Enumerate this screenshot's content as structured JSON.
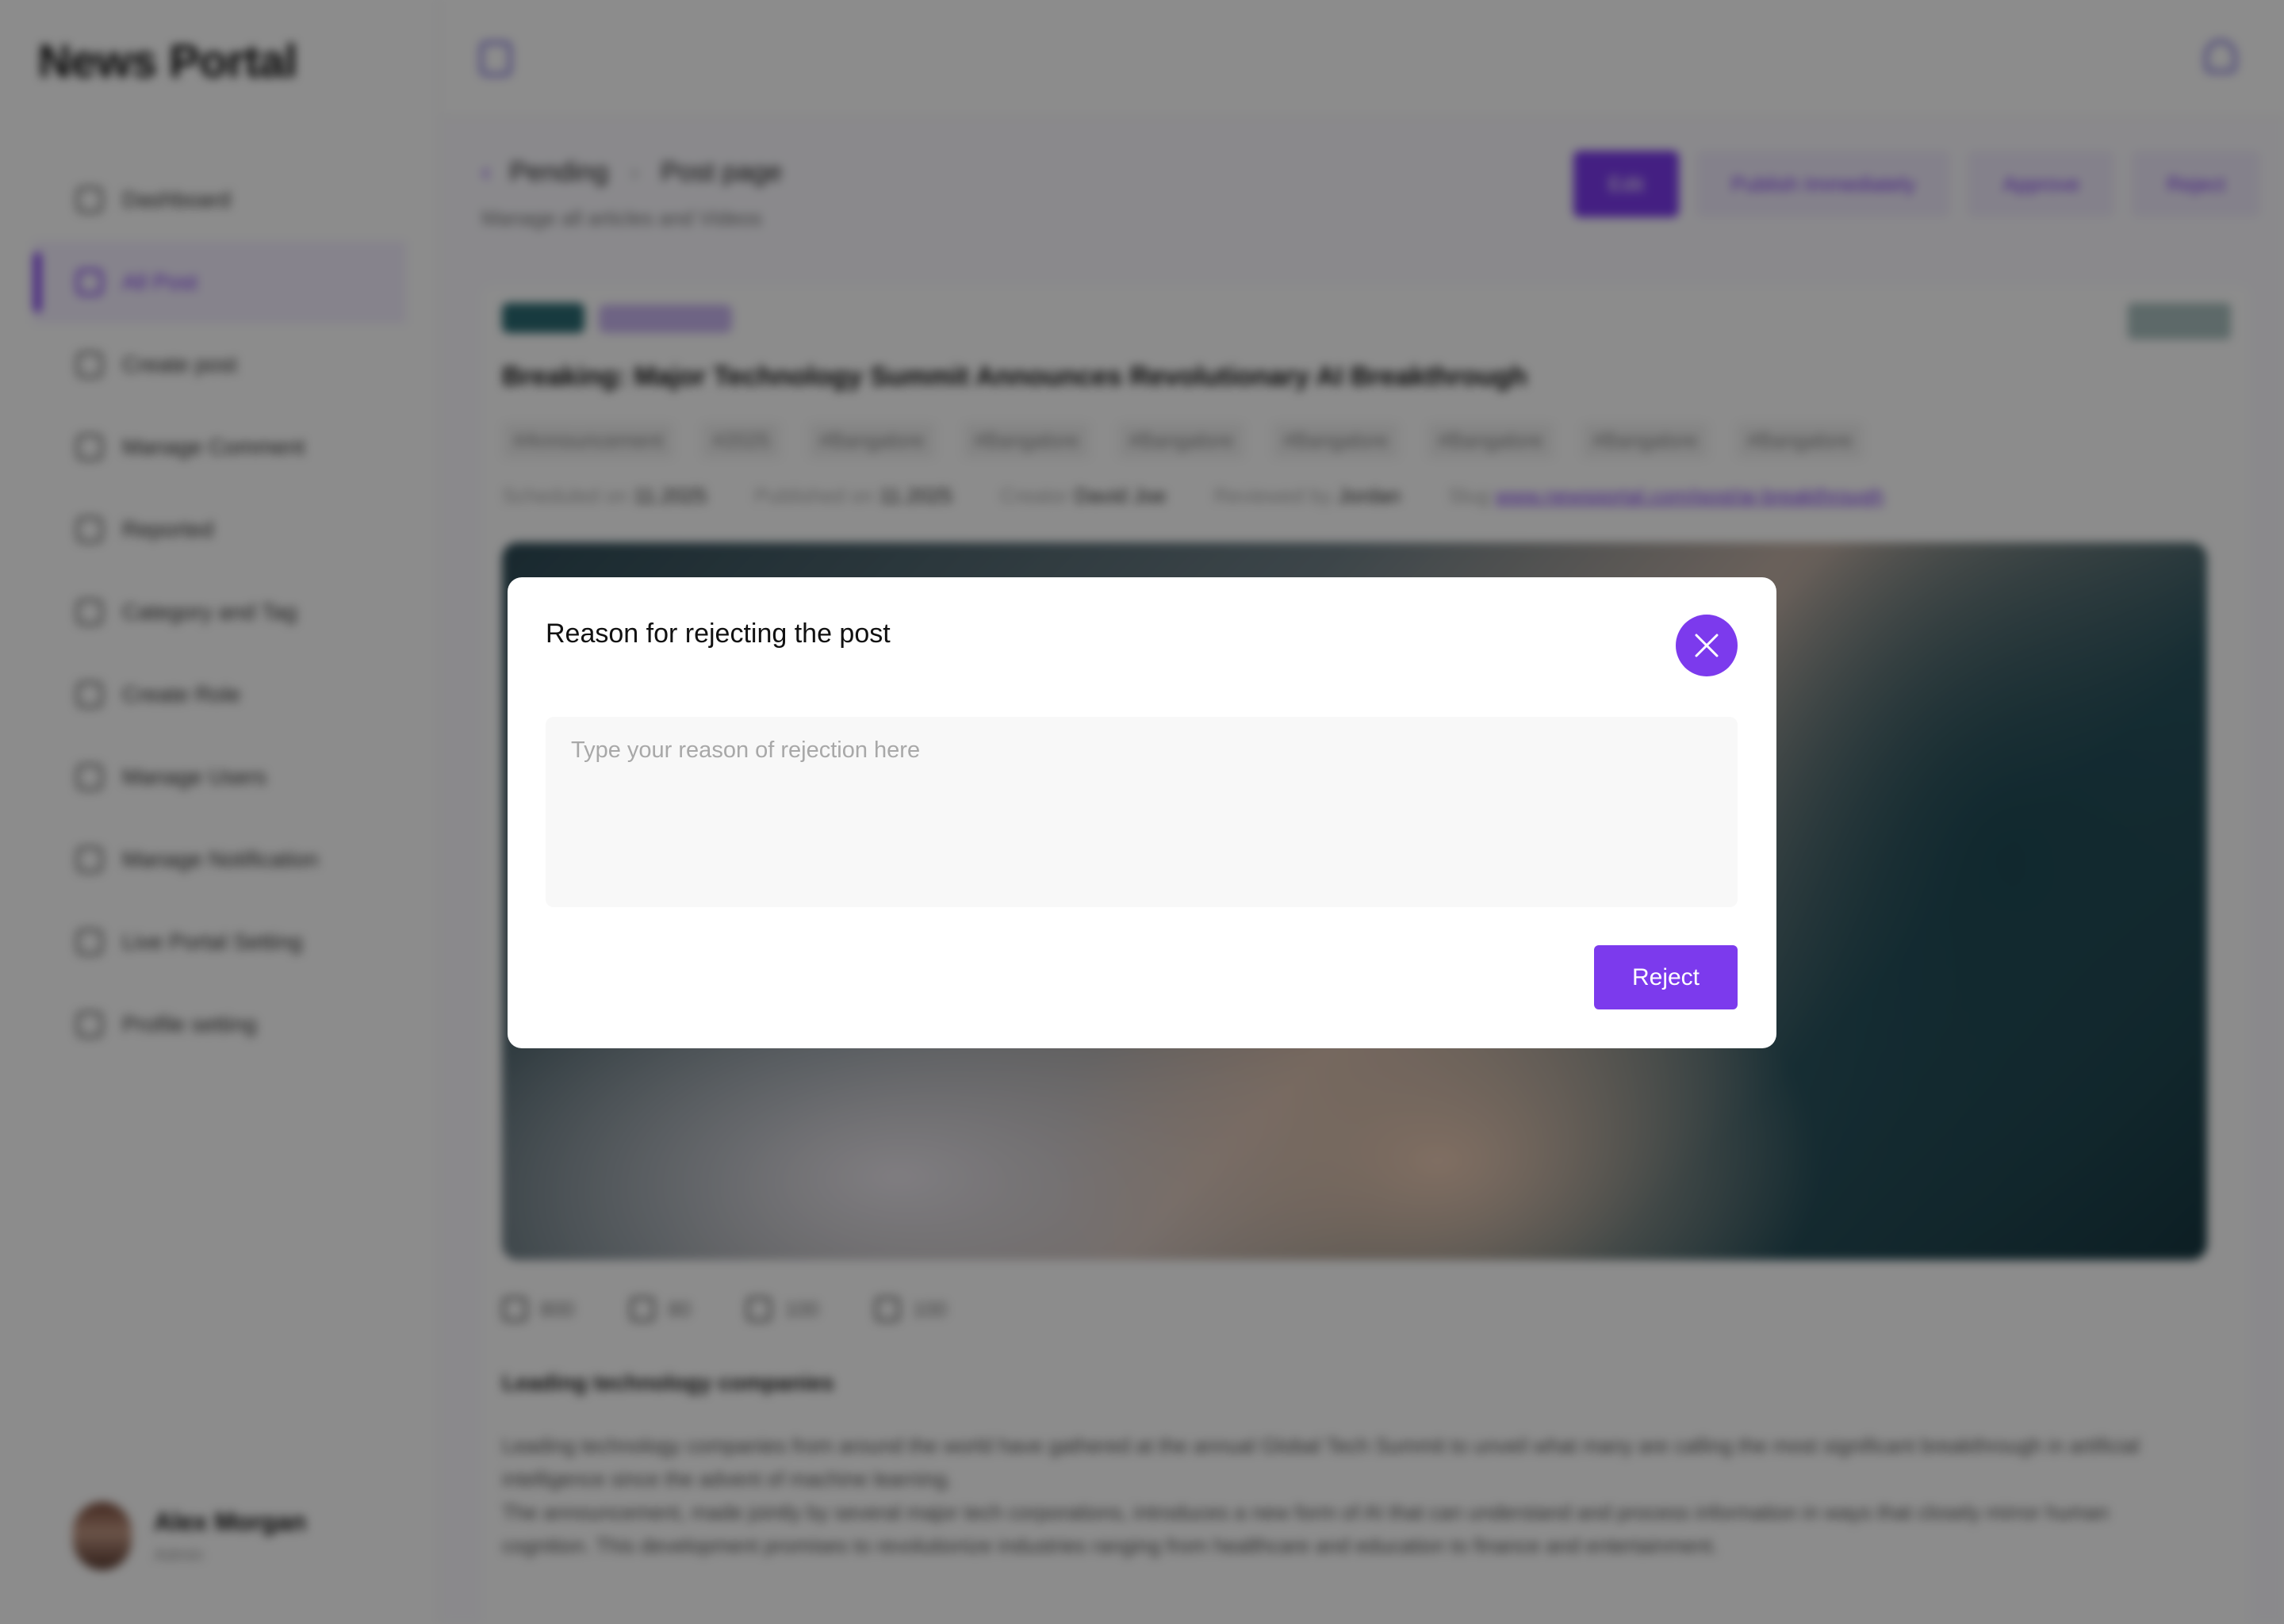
{
  "brand": "News Portal",
  "sidebar": {
    "items": [
      {
        "label": "Dashboard",
        "icon": "dashboard-icon"
      },
      {
        "label": "All Post",
        "icon": "document-icon",
        "active": true
      },
      {
        "label": "Create post",
        "icon": "plus-circle-icon"
      },
      {
        "label": "Manage Comment",
        "icon": "comment-icon"
      },
      {
        "label": "Reported",
        "icon": "flag-icon"
      },
      {
        "label": "Category and Tag",
        "icon": "tag-icon"
      },
      {
        "label": "Create Role",
        "icon": "user-icon"
      },
      {
        "label": "Manage Users",
        "icon": "users-icon"
      },
      {
        "label": "Manage Notification",
        "icon": "bell-icon"
      },
      {
        "label": "Live Portal Setting",
        "icon": "calendar-icon"
      },
      {
        "label": "Profile setting",
        "icon": "gear-icon"
      }
    ]
  },
  "profile": {
    "name": "Alex Morgan",
    "role": "Admin"
  },
  "header": {
    "crumb_1": "Pending",
    "crumb_2": "Post page",
    "subtitle": "Manage all articles and Videos",
    "actions": {
      "edit": "Edit",
      "publish": "Publish Immediately",
      "approve": "Approve",
      "reject": "Reject"
    }
  },
  "post": {
    "title": "Breaking: Major Technology Summit Announces Revolutionary AI Breakthrough",
    "tags": [
      "#Announcement",
      "#2025",
      "#Bangalore",
      "#Bangalore",
      "#Bangalore",
      "#Bangalore",
      "#Bangalore",
      "#Bangalore",
      "#Bangalore"
    ],
    "meta": {
      "scheduled_label": "Scheduled on",
      "scheduled": "11.2025",
      "published_label": "Published on",
      "published": "11.2025",
      "created_label": "Creator",
      "creator": "David Joe",
      "reviewed_label": "Reviewed by",
      "reviewer": "Jordan",
      "slug_label": "Slug",
      "slug": "www.newsportal.com/post/ai-breakthrough"
    },
    "stats": {
      "views": "800",
      "likes": "80",
      "comments": "100",
      "shares": "100"
    },
    "section_title": "Leading technology companies",
    "body_1": "Leading technology companies from around the world have gathered at the annual Global Tech Summit to unveil what many are calling the most significant breakthrough in artificial intelligence since the advent of machine learning.",
    "body_2": "The announcement, made jointly by several major tech corporations, introduces a new form of AI that can understand and process information in ways that closely mirror human cognition. This development promises to revolutionize industries ranging from healthcare and education to finance and entertainment."
  },
  "modal": {
    "title": "Reason for rejecting the post",
    "placeholder": "Type your reason of rejection here",
    "value": "",
    "reject_label": "Reject",
    "close_icon": "close-icon"
  },
  "colors": {
    "accent": "#7c3aed",
    "overlay": "rgba(0,0,0,0.45)"
  }
}
